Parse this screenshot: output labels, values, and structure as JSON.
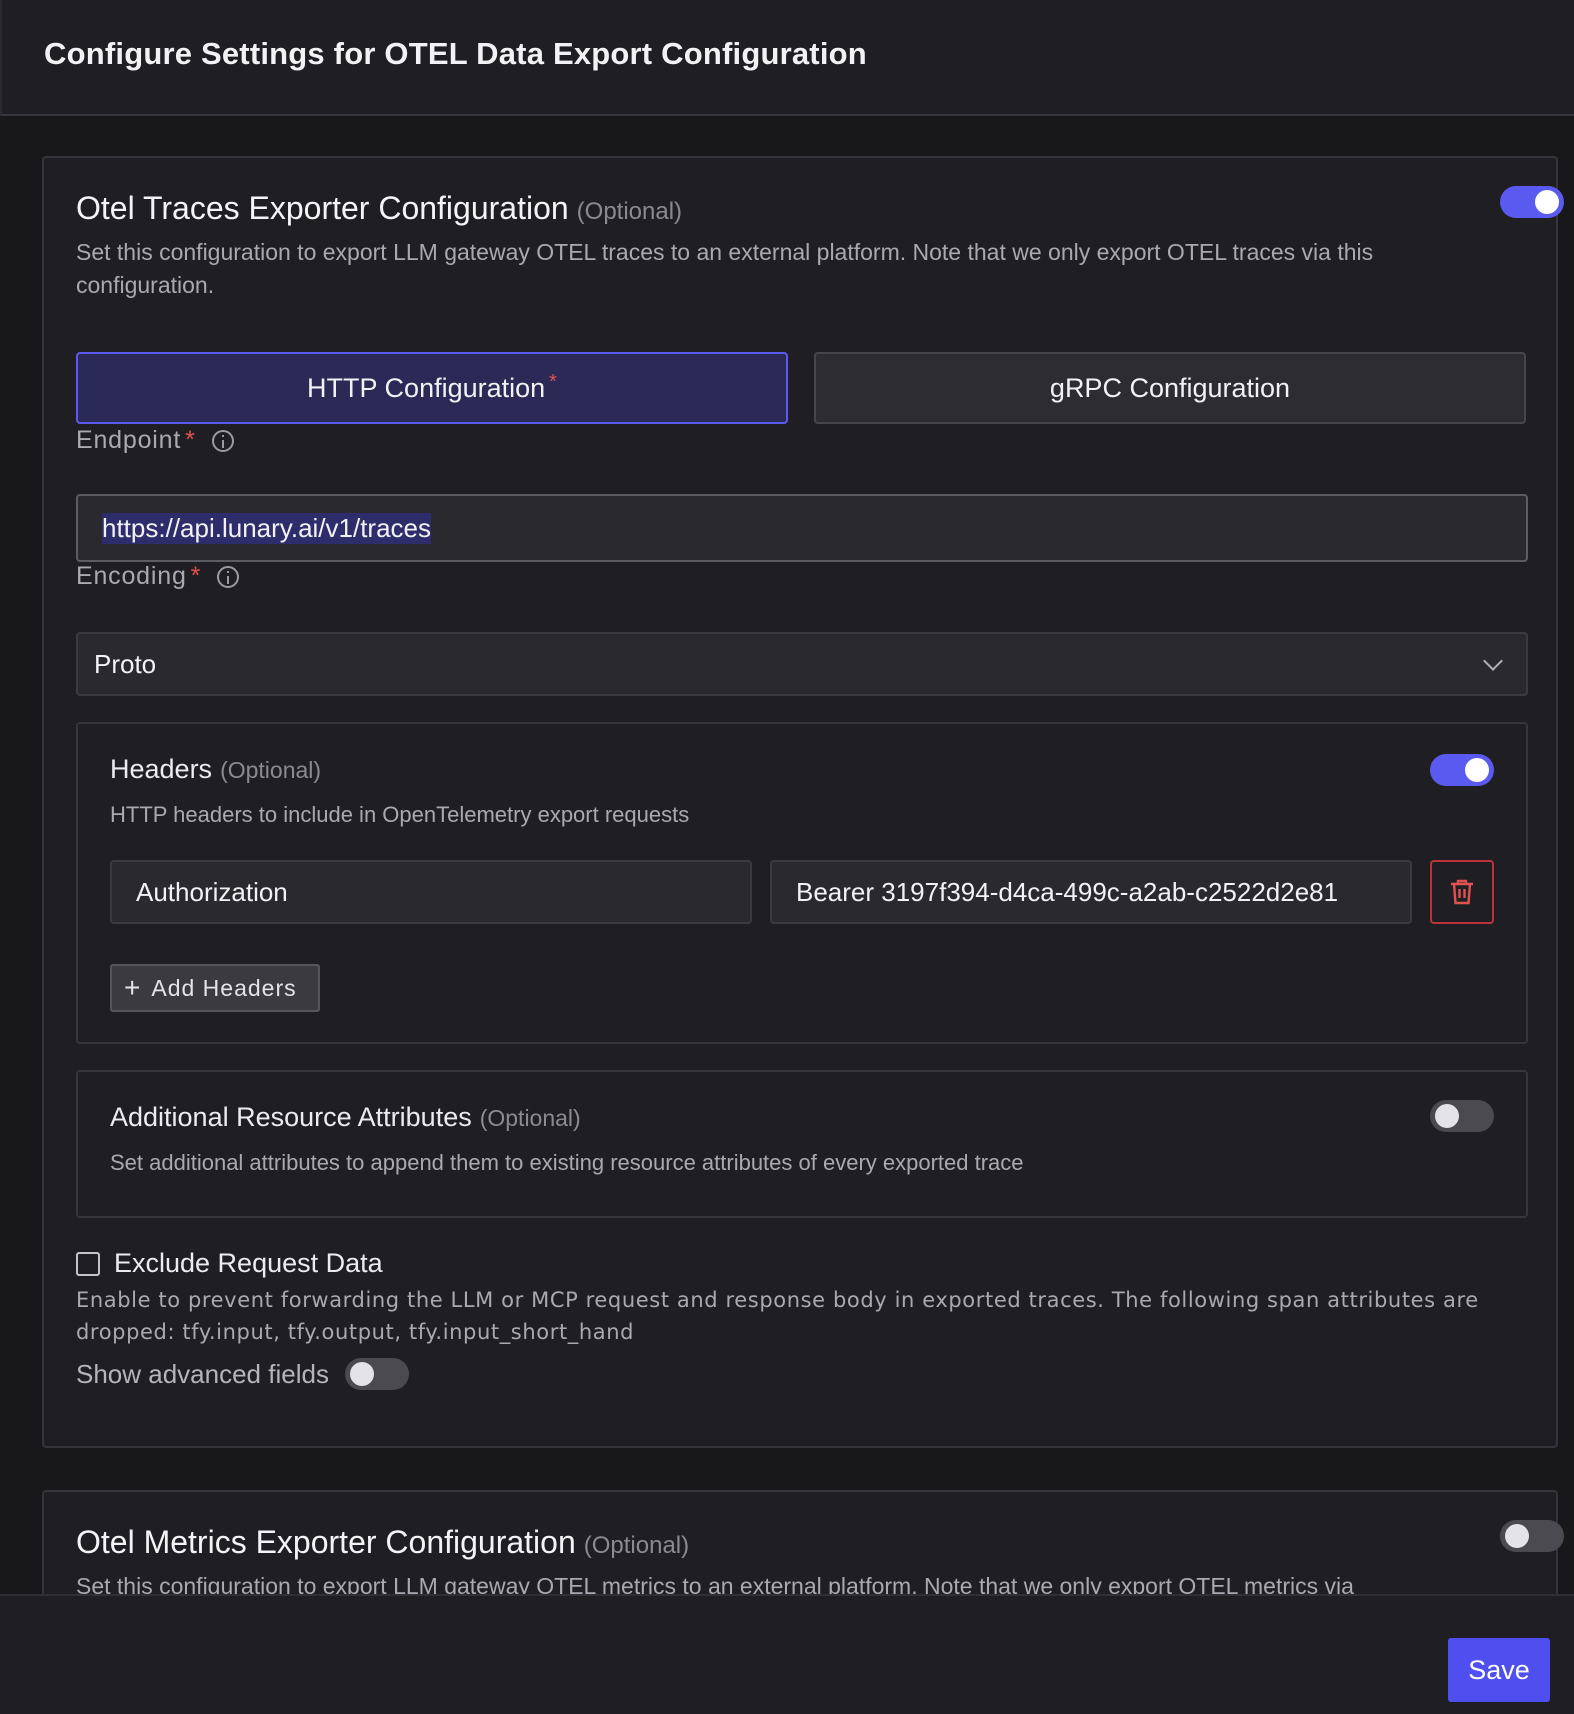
{
  "header": {
    "title": "Configure Settings for OTEL Data Export Configuration"
  },
  "traces": {
    "title": "Otel Traces Exporter Configuration",
    "optional": "(Optional)",
    "enabled": true,
    "description": "Set this configuration to export LLM gateway OTEL traces to an external platform. Note that we only export OTEL traces via this configuration.",
    "tabs": [
      {
        "label": "HTTP Configuration",
        "required": "*",
        "active": true
      },
      {
        "label": "gRPC Configuration",
        "active": false
      }
    ],
    "endpoint": {
      "label": "Endpoint",
      "required": "*",
      "value": "https://api.lunary.ai/v1/traces"
    },
    "encoding": {
      "label": "Encoding",
      "required": "*",
      "value": "Proto"
    },
    "headers": {
      "title": "Headers",
      "optional": "(Optional)",
      "enabled": true,
      "description": "HTTP headers to include in OpenTelemetry export requests",
      "rows": [
        {
          "key": "Authorization",
          "value": "Bearer 3197f394-d4ca-499c-a2ab-c2522d2e81"
        }
      ],
      "add_label": "Add Headers"
    },
    "attributes": {
      "title": "Additional Resource Attributes",
      "optional": "(Optional)",
      "enabled": false,
      "description": "Set additional attributes to append them to existing resource attributes of every exported trace"
    },
    "exclude": {
      "label": "Exclude Request Data",
      "checked": false,
      "description": "Enable to prevent forwarding the LLM or MCP request and response body in exported traces. The following span attributes are dropped: tfy.input, tfy.output, tfy.input_short_hand"
    },
    "advanced": {
      "label": "Show advanced fields",
      "enabled": false
    }
  },
  "metrics": {
    "title": "Otel Metrics Exporter Configuration",
    "optional": "(Optional)",
    "enabled": false,
    "description": "Set this configuration to export LLM gateway OTEL metrics to an external platform. Note that we only export OTEL metrics via"
  },
  "footer": {
    "save_label": "Save"
  },
  "colors": {
    "accent": "#5a5af0",
    "danger": "#e0524f",
    "background": "#18181b"
  }
}
